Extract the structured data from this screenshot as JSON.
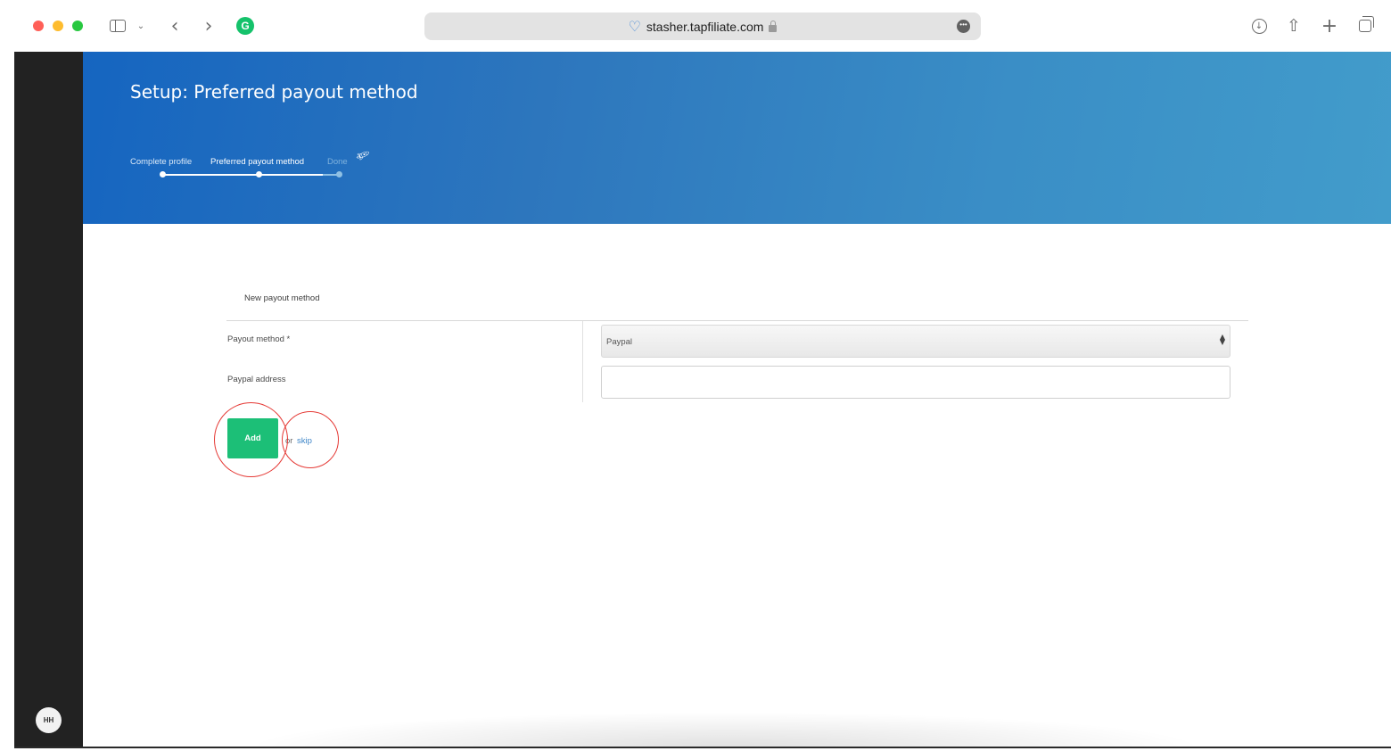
{
  "browser": {
    "url": "stasher.tapfiliate.com",
    "icons": [
      "sidebar-toggle-icon",
      "chevron-down-icon",
      "back-icon",
      "forward-icon",
      "grammarly-icon",
      "site-favicon-icon",
      "lock-icon",
      "more-icon",
      "download-icon",
      "share-icon",
      "new-tab-icon",
      "tab-overview-icon"
    ],
    "extension_letter": "G"
  },
  "sidebar": {
    "avatar_initials": "HH"
  },
  "header": {
    "title": "Setup: Preferred payout method",
    "steps": [
      {
        "label": "Complete profile",
        "state": "done"
      },
      {
        "label": "Preferred payout method",
        "state": "current"
      },
      {
        "label": "Done",
        "state": "upcoming"
      }
    ]
  },
  "form": {
    "section_title": "New payout method",
    "payout_method_label": "Payout method *",
    "payout_method_value": "Paypal",
    "paypal_address_label": "Paypal address",
    "paypal_address_value": "",
    "add_label": "Add",
    "or_text": "or",
    "skip_label": "skip"
  },
  "colors": {
    "accent_green": "#1cbf77",
    "header_gradient_start": "#1565c0",
    "header_gradient_end": "#429ccb",
    "link_blue": "#3f86c8",
    "annotation_red": "#e53935"
  }
}
